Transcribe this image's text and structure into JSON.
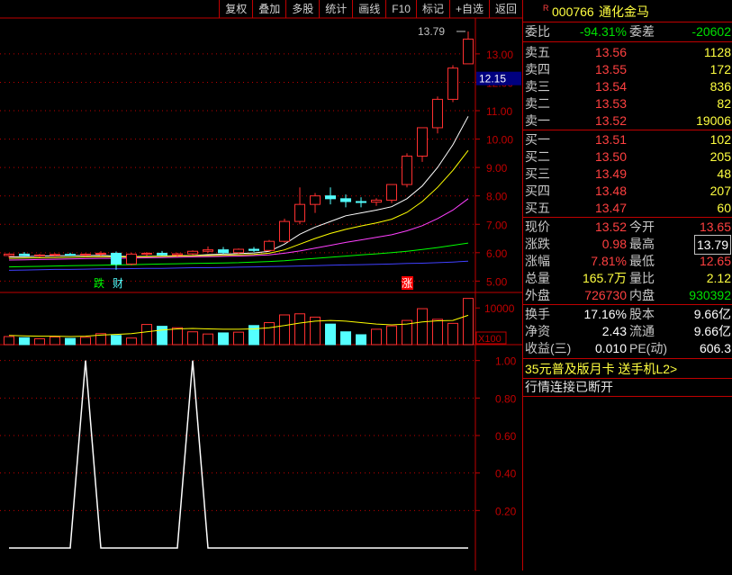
{
  "toolbar": [
    "复权",
    "叠加",
    "多股",
    "统计",
    "画线",
    "F10",
    "标记",
    "+自选",
    "返回"
  ],
  "stock": {
    "badge": "R",
    "code": "000766",
    "name": "通化金马"
  },
  "weibi": {
    "label": "委比",
    "value": "-94.31%",
    "label2": "委差",
    "value2": "-20602"
  },
  "asks": [
    {
      "label": "卖五",
      "price": "13.56",
      "vol": "1128"
    },
    {
      "label": "卖四",
      "price": "13.55",
      "vol": "172"
    },
    {
      "label": "卖三",
      "price": "13.54",
      "vol": "836"
    },
    {
      "label": "卖二",
      "price": "13.53",
      "vol": "82"
    },
    {
      "label": "卖一",
      "price": "13.52",
      "vol": "19006"
    }
  ],
  "bids": [
    {
      "label": "买一",
      "price": "13.51",
      "vol": "102"
    },
    {
      "label": "买二",
      "price": "13.50",
      "vol": "205"
    },
    {
      "label": "买三",
      "price": "13.49",
      "vol": "48"
    },
    {
      "label": "买四",
      "price": "13.48",
      "vol": "207"
    },
    {
      "label": "买五",
      "price": "13.47",
      "vol": "60"
    }
  ],
  "quote": [
    {
      "l1": "现价",
      "v1": "13.52",
      "l2": "今开",
      "v2": "13.65"
    },
    {
      "l1": "涨跌",
      "v1": "0.98",
      "l2": "最高",
      "v2": "13.79"
    },
    {
      "l1": "涨幅",
      "v1": "7.81%",
      "l2": "最低",
      "v2": "12.65"
    },
    {
      "l1": "总量",
      "v1": "165.7万",
      "l2": "量比",
      "v2": "2.12"
    },
    {
      "l1": "外盘",
      "v1": "726730",
      "l2": "内盘",
      "v2": "930392"
    }
  ],
  "stats": [
    {
      "l1": "换手",
      "v1": "17.16%",
      "l2": "股本",
      "v2": "9.66亿"
    },
    {
      "l1": "净资",
      "v1": "2.43",
      "l2": "流通",
      "v2": "9.66亿"
    },
    {
      "l1": "收益(三)",
      "v1": "0.010",
      "l2": "PE(动)",
      "v2": "606.3"
    }
  ],
  "promo": "35元普及版月卡 送手机L2>",
  "status": "行情连接已断开",
  "colors": {
    "up": "#ff3030",
    "down": "#54ffff",
    "ma1": "#ffffff",
    "ma2": "#ffff00",
    "ma3": "#ff40ff",
    "ma4": "#00ff00",
    "ma5": "#4040ff",
    "grid": "#c00000"
  },
  "chart_data": [
    {
      "type": "candlestick",
      "y_ticks": [
        "13.00",
        "12.00",
        "11.00",
        "10.00",
        "9.00",
        "8.00",
        "7.00",
        "6.00",
        "5.00"
      ],
      "ylim": [
        4.6,
        14.2
      ],
      "current_price_label": "12.15",
      "high_label": "13.79",
      "markers": [
        "跌",
        "财",
        "涨"
      ],
      "ohlc": [
        [
          5.9,
          5.98,
          5.82,
          5.95
        ],
        [
          5.95,
          6.02,
          5.88,
          5.9
        ],
        [
          5.9,
          5.96,
          5.84,
          5.92
        ],
        [
          5.92,
          5.98,
          5.86,
          5.94
        ],
        [
          5.94,
          6.0,
          5.88,
          5.92
        ],
        [
          5.92,
          5.98,
          5.86,
          5.95
        ],
        [
          5.95,
          6.05,
          5.88,
          5.98
        ],
        [
          5.98,
          6.04,
          5.4,
          5.6
        ],
        [
          5.6,
          6.0,
          5.55,
          5.95
        ],
        [
          5.95,
          6.02,
          5.88,
          5.98
        ],
        [
          5.98,
          6.06,
          5.9,
          5.92
        ],
        [
          5.92,
          6.0,
          5.85,
          5.96
        ],
        [
          5.96,
          6.08,
          5.92,
          6.05
        ],
        [
          6.05,
          6.22,
          6.0,
          6.1
        ],
        [
          6.1,
          6.2,
          5.95,
          6.0
        ],
        [
          6.0,
          6.15,
          5.95,
          6.12
        ],
        [
          6.12,
          6.2,
          6.02,
          6.08
        ],
        [
          6.08,
          6.45,
          6.05,
          6.4
        ],
        [
          6.4,
          7.2,
          6.35,
          7.1
        ],
        [
          7.1,
          8.3,
          7.0,
          7.7
        ],
        [
          7.7,
          8.1,
          7.4,
          8.0
        ],
        [
          8.0,
          8.3,
          7.7,
          7.9
        ],
        [
          7.9,
          8.05,
          7.6,
          7.8
        ],
        [
          7.8,
          7.95,
          7.6,
          7.78
        ],
        [
          7.78,
          7.92,
          7.65,
          7.85
        ],
        [
          7.85,
          8.1,
          7.75,
          8.4
        ],
        [
          8.4,
          9.5,
          8.3,
          9.4
        ],
        [
          9.4,
          10.4,
          9.2,
          10.4
        ],
        [
          10.4,
          11.5,
          10.2,
          11.4
        ],
        [
          11.4,
          12.6,
          11.3,
          12.5
        ],
        [
          12.65,
          13.79,
          12.65,
          13.52
        ]
      ],
      "ma": {
        "ma1": [
          5.85,
          5.86,
          5.88,
          5.89,
          5.9,
          5.9,
          5.91,
          5.88,
          5.86,
          5.87,
          5.88,
          5.89,
          5.9,
          5.93,
          5.95,
          5.97,
          5.99,
          6.05,
          6.3,
          6.65,
          6.9,
          7.1,
          7.3,
          7.4,
          7.5,
          7.62,
          7.9,
          8.35,
          9.0,
          9.8,
          10.8
        ],
        "ma2": [
          5.8,
          5.81,
          5.82,
          5.83,
          5.84,
          5.85,
          5.86,
          5.85,
          5.85,
          5.86,
          5.87,
          5.88,
          5.89,
          5.9,
          5.91,
          5.92,
          5.94,
          5.98,
          6.1,
          6.3,
          6.5,
          6.68,
          6.82,
          6.94,
          7.05,
          7.18,
          7.42,
          7.8,
          8.3,
          8.9,
          9.6
        ],
        "ma3": [
          5.74,
          5.75,
          5.76,
          5.77,
          5.78,
          5.79,
          5.8,
          5.8,
          5.81,
          5.82,
          5.83,
          5.84,
          5.85,
          5.86,
          5.87,
          5.88,
          5.9,
          5.92,
          5.98,
          6.06,
          6.16,
          6.26,
          6.36,
          6.45,
          6.54,
          6.63,
          6.77,
          6.95,
          7.2,
          7.5,
          7.9
        ],
        "ma4": [
          5.5,
          5.51,
          5.52,
          5.53,
          5.54,
          5.55,
          5.56,
          5.57,
          5.58,
          5.59,
          5.6,
          5.61,
          5.62,
          5.63,
          5.64,
          5.65,
          5.67,
          5.69,
          5.72,
          5.76,
          5.8,
          5.84,
          5.88,
          5.92,
          5.96,
          6.0,
          6.05,
          6.11,
          6.18,
          6.26,
          6.34
        ],
        "ma5": [
          5.38,
          5.39,
          5.4,
          5.41,
          5.41,
          5.42,
          5.43,
          5.43,
          5.44,
          5.45,
          5.45,
          5.46,
          5.47,
          5.47,
          5.48,
          5.49,
          5.5,
          5.51,
          5.52,
          5.53,
          5.54,
          5.56,
          5.57,
          5.58,
          5.59,
          5.6,
          5.62,
          5.63,
          5.65,
          5.67,
          5.7
        ]
      }
    },
    {
      "type": "bar",
      "name_label": "X100",
      "y_ticks": [
        "10000"
      ],
      "ylim": [
        0,
        13000
      ],
      "values": [
        2200,
        1900,
        1600,
        2100,
        1700,
        2000,
        3000,
        2500,
        1800,
        5500,
        5000,
        4600,
        3500,
        2900,
        3200,
        3400,
        5200,
        6000,
        8100,
        8400,
        7500,
        5600,
        3500,
        2700,
        4200,
        5100,
        6600,
        9800,
        6900,
        5800,
        12600
      ],
      "ma": [
        2500,
        2400,
        2300,
        2300,
        2200,
        2300,
        2600,
        2800,
        3000,
        3500,
        4000,
        4300,
        4400,
        4300,
        4200,
        4200,
        4300,
        4600,
        5200,
        5900,
        6400,
        6600,
        6400,
        6000,
        5600,
        5400,
        5600,
        6200,
        6500,
        6600,
        8000
      ]
    },
    {
      "type": "line",
      "y_ticks": [
        "1.00",
        "0.80",
        "0.60",
        "0.40",
        "0.20"
      ],
      "ylim": [
        -0.12,
        1.08
      ],
      "values": [
        0,
        0,
        0,
        0,
        0,
        1,
        0,
        0,
        0,
        0,
        0,
        0,
        1,
        0,
        0,
        0,
        0,
        0,
        0,
        0,
        0,
        0,
        0,
        0,
        0,
        0,
        0,
        0,
        0,
        0,
        0
      ]
    }
  ]
}
